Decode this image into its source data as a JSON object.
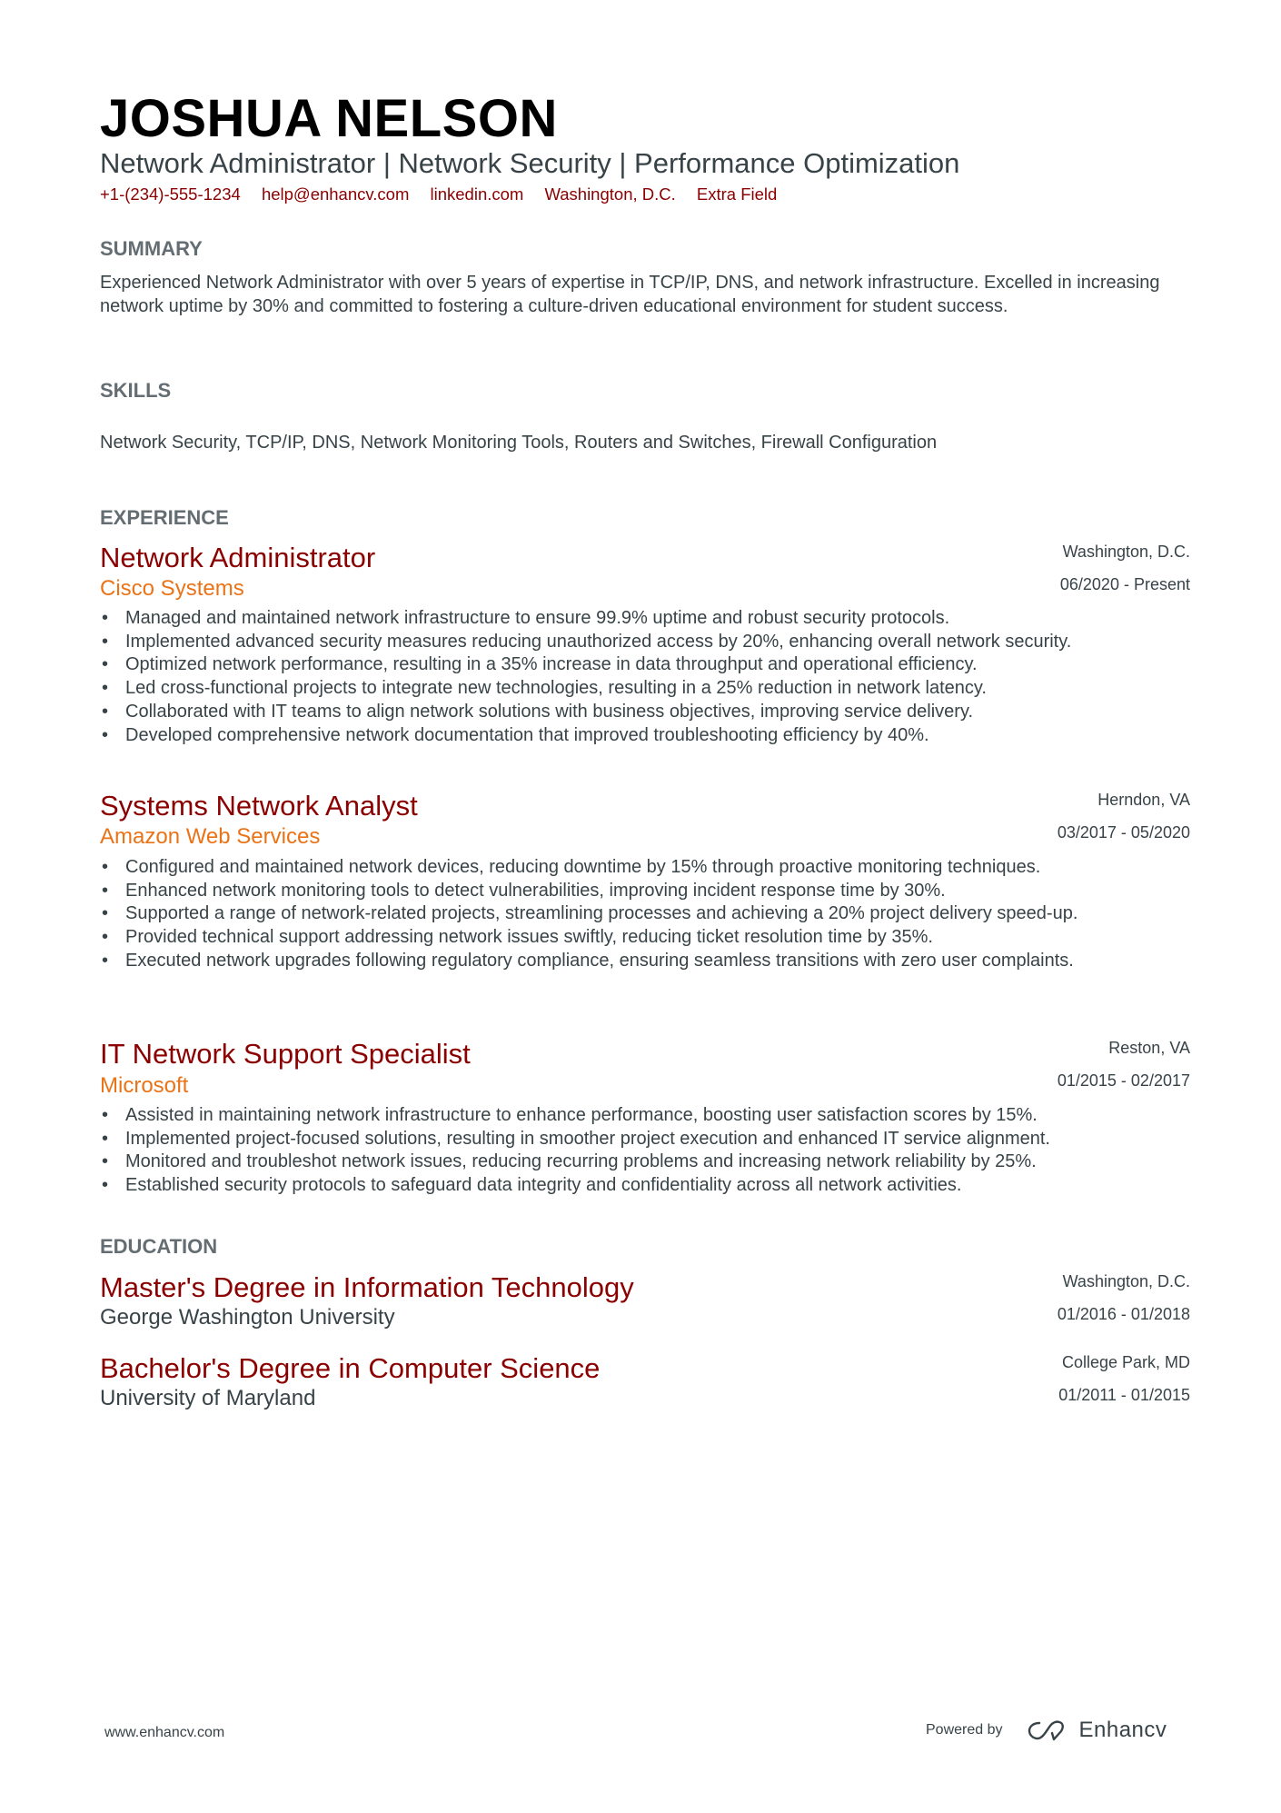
{
  "header": {
    "name": "JOSHUA NELSON",
    "subtitle": "Network Administrator | Network Security | Performance Optimization",
    "contacts": [
      "+1-(234)-555-1234",
      "help@enhancv.com",
      "linkedin.com",
      "Washington, D.C.",
      "Extra Field"
    ]
  },
  "summary": {
    "title": "SUMMARY",
    "text": "Experienced Network Administrator with over 5 years of expertise in TCP/IP, DNS, and network infrastructure. Excelled in increasing network uptime by 30% and committed to fostering a culture-driven educational environment for student success."
  },
  "skills": {
    "title": "SKILLS",
    "text": "Network Security, TCP/IP, DNS, Network Monitoring Tools, Routers and Switches, Firewall Configuration"
  },
  "experience": {
    "title": "EXPERIENCE",
    "jobs": [
      {
        "title": "Network Administrator",
        "company": "Cisco Systems",
        "location": "Washington, D.C.",
        "dates": "06/2020 - Present",
        "bullets": [
          "Managed and maintained network infrastructure to ensure 99.9% uptime and robust security protocols.",
          "Implemented advanced security measures reducing unauthorized access by 20%, enhancing overall network security.",
          "Optimized network performance, resulting in a 35% increase in data throughput and operational efficiency.",
          "Led cross-functional projects to integrate new technologies, resulting in a 25% reduction in network latency.",
          "Collaborated with IT teams to align network solutions with business objectives, improving service delivery.",
          "Developed comprehensive network documentation that improved troubleshooting efficiency by 40%."
        ]
      },
      {
        "title": "Systems Network Analyst",
        "company": "Amazon Web Services",
        "location": "Herndon, VA",
        "dates": "03/2017 - 05/2020",
        "bullets": [
          "Configured and maintained network devices, reducing downtime by 15% through proactive monitoring techniques.",
          "Enhanced network monitoring tools to detect vulnerabilities, improving incident response time by 30%.",
          "Supported a range of network-related projects, streamlining processes and achieving a 20% project delivery speed-up.",
          "Provided technical support addressing network issues swiftly, reducing ticket resolution time by 35%.",
          "Executed network upgrades following regulatory compliance, ensuring seamless transitions with zero user complaints."
        ]
      },
      {
        "title": "IT Network Support Specialist",
        "company": "Microsoft",
        "location": "Reston, VA",
        "dates": "01/2015 - 02/2017",
        "bullets": [
          "Assisted in maintaining network infrastructure to enhance performance, boosting user satisfaction scores by 15%.",
          "Implemented project-focused solutions, resulting in smoother project execution and enhanced IT service alignment.",
          "Monitored and troubleshot network issues, reducing recurring problems and increasing network reliability by 25%.",
          "Established security protocols to safeguard data integrity and confidentiality across all network activities."
        ]
      }
    ]
  },
  "education": {
    "title": "EDUCATION",
    "items": [
      {
        "degree": "Master's Degree in Information Technology",
        "school": "George Washington University",
        "location": "Washington, D.C.",
        "dates": "01/2016 - 01/2018"
      },
      {
        "degree": "Bachelor's Degree in Computer Science",
        "school": "University of Maryland",
        "location": "College Park, MD",
        "dates": "01/2011 - 01/2015"
      }
    ]
  },
  "footer": {
    "website": "www.enhancv.com",
    "powered_by": "Powered by",
    "brand": "Enhancv",
    "logo_icon": "enhancv-logo-icon"
  },
  "colors": {
    "accent": "#8b0000",
    "company": "#ea7317",
    "heading": "#646d72",
    "text": "#384347"
  }
}
